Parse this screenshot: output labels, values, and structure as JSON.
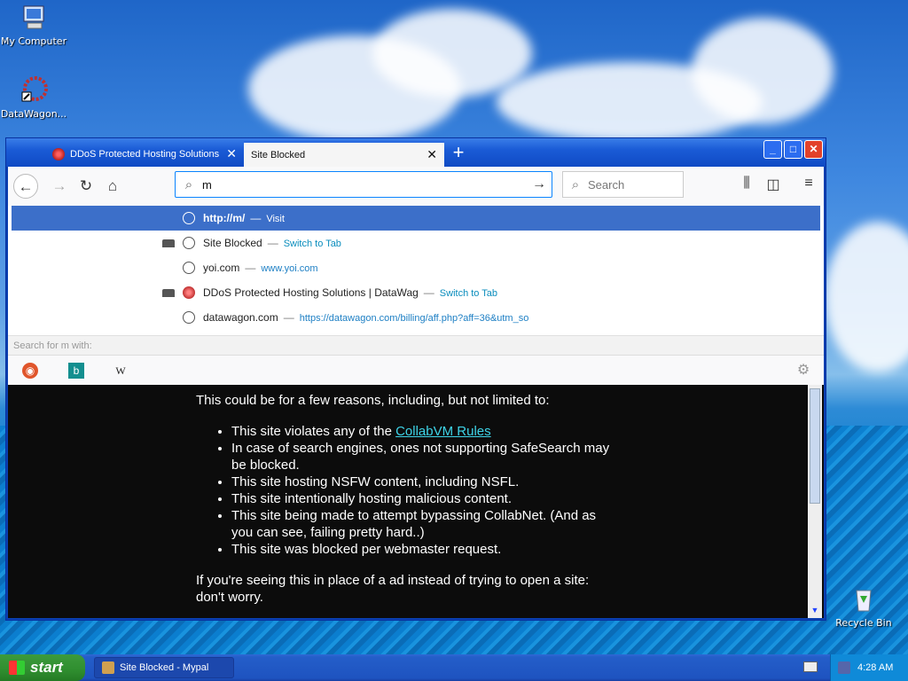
{
  "desktop": {
    "icons": [
      {
        "label": "My Computer"
      },
      {
        "label": "DataWagon..."
      },
      {
        "label": "Recycle Bin"
      }
    ]
  },
  "browser": {
    "tabs": [
      {
        "label": "DDoS Protected Hosting Solutions"
      },
      {
        "label": "Site Blocked"
      }
    ],
    "url_value": "m",
    "search_placeholder": "Search",
    "suggestions": [
      {
        "title": "http://m/",
        "action": "Visit"
      },
      {
        "title": "Site Blocked",
        "action": "Switch to Tab"
      },
      {
        "title": "yoi.com",
        "url": "www.yoi.com"
      },
      {
        "title": "DDoS Protected Hosting Solutions | DataWag",
        "action": "Switch to Tab"
      },
      {
        "title": "datawagon.com",
        "url": "https://datawagon.com/billing/aff.php?aff=36&utm_so"
      }
    ],
    "search_with": "Search for m with:",
    "engines": [
      "DuckDuckGo",
      "Bing",
      "Wikipedia"
    ],
    "engine_glyphs": {
      "wiki": "W"
    }
  },
  "page": {
    "intro": "This could be for a few reasons, including, but not limited to:",
    "reasons": [
      {
        "before": "This site violates any of the ",
        "link": "CollabVM Rules",
        "after": ""
      },
      {
        "before": "In case of search engines, ones not supporting SafeSearch may be blocked.",
        "link": "",
        "after": ""
      },
      {
        "before": "This site hosting NSFW content, including NSFL.",
        "link": "",
        "after": ""
      },
      {
        "before": "This site intentionally hosting malicious content.",
        "link": "",
        "after": ""
      },
      {
        "before": "This site being made to attempt bypassing CollabNet. (And as you can see, failing pretty hard..)",
        "link": "",
        "after": ""
      },
      {
        "before": "This site was blocked per webmaster request.",
        "link": "",
        "after": ""
      }
    ],
    "outro": "If you're seeing this in place of a ad instead of trying to open a site: don't worry."
  },
  "taskbar": {
    "start_label": "start",
    "task_label": "Site Blocked - Mypal",
    "clock": "4:28 AM"
  }
}
